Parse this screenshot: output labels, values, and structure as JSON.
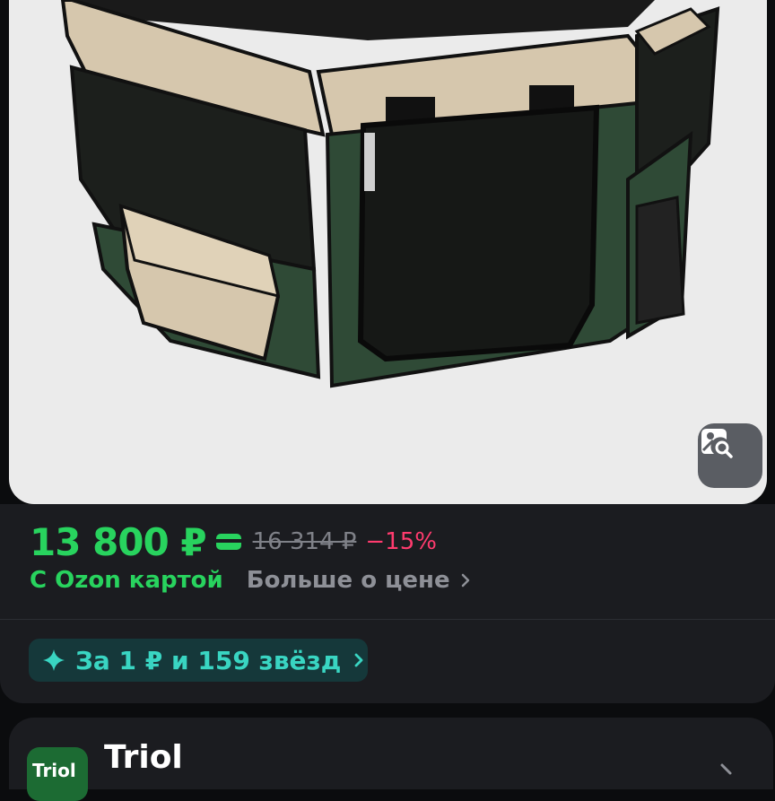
{
  "product": {
    "price": "13 800 ₽",
    "old_price": "16 314 ₽",
    "discount": "−15%",
    "ozon_card_label": "С Ozon картой",
    "more_about_price": "Больше о цене",
    "stars_offer": "За 1 ₽ и 159 звёзд"
  },
  "seller": {
    "logo_text": "Triol",
    "name": "Triol"
  },
  "colors": {
    "price_green": "#28d35e",
    "discount_pink": "#ff3b6e",
    "stars_teal": "#39d5c2",
    "panel_bg": "#1b1c20"
  },
  "icons": {
    "photo_search": "image-search-icon",
    "ozon_card": "card-icon",
    "sparkle": "sparkle-icon",
    "chevron": "chevron-right-icon"
  }
}
